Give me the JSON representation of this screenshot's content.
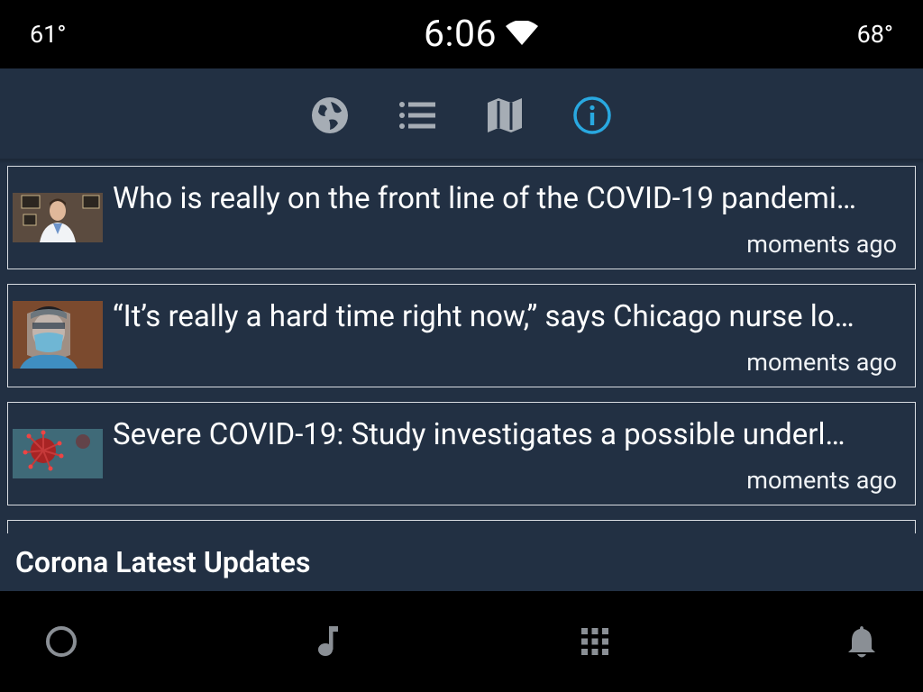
{
  "status": {
    "temp_left": "61°",
    "temp_right": "68°",
    "time": "6:06"
  },
  "tabs": [
    {
      "name": "globe-icon",
      "active": false
    },
    {
      "name": "list-icon",
      "active": false
    },
    {
      "name": "map-icon",
      "active": false
    },
    {
      "name": "info-icon",
      "active": true
    }
  ],
  "colors": {
    "background": "#223043",
    "active_tab": "#29a8e0",
    "inactive_tab": "#a6adb5"
  },
  "articles": [
    {
      "headline": "Who is really on the front line of the COVID-19 pandemi…",
      "time": "moments ago",
      "thumb": "doctor-photo"
    },
    {
      "headline": "“It’s really a hard time right now,” says Chicago nurse lo…",
      "time": "moments ago",
      "thumb": "nurse-face-shield-photo"
    },
    {
      "headline": "Severe COVID-19: Study investigates a possible underl…",
      "time": "moments ago",
      "thumb": "virus-illustration"
    }
  ],
  "footer": {
    "title": "Corona Latest Updates"
  },
  "nav": [
    "home-circle-icon",
    "music-note-icon",
    "apps-grid-icon",
    "notification-bell-icon"
  ]
}
